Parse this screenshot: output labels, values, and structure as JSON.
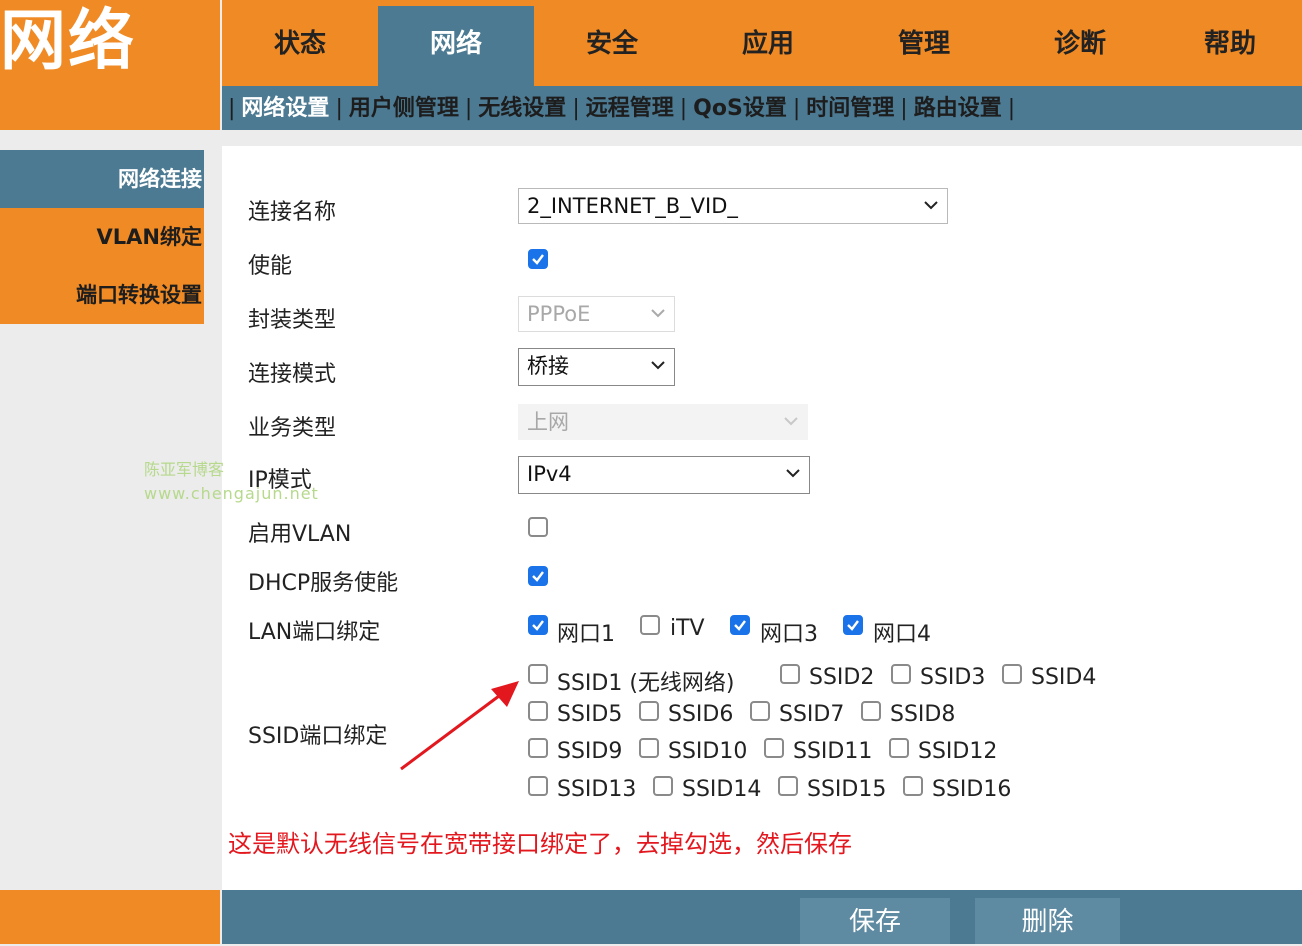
{
  "logo": {
    "text": "网络"
  },
  "topnav": {
    "tabs": [
      {
        "label": "状态",
        "active": false
      },
      {
        "label": "网络",
        "active": true
      },
      {
        "label": "安全",
        "active": false
      },
      {
        "label": "应用",
        "active": false
      },
      {
        "label": "管理",
        "active": false
      },
      {
        "label": "诊断",
        "active": false
      },
      {
        "label": "帮助",
        "active": false
      }
    ]
  },
  "subnav": {
    "items": [
      {
        "label": "网络设置",
        "active": true
      },
      {
        "label": "用户侧管理",
        "active": false
      },
      {
        "label": "无线设置",
        "active": false
      },
      {
        "label": "远程管理",
        "active": false
      },
      {
        "label": "QoS设置",
        "active": false
      },
      {
        "label": "时间管理",
        "active": false
      },
      {
        "label": "路由设置",
        "active": false
      }
    ],
    "separator": "|"
  },
  "sidebar": {
    "items": [
      {
        "label": "网络连接",
        "active": true
      },
      {
        "label": "VLAN绑定",
        "active": false
      },
      {
        "label": "端口转换设置",
        "active": false
      }
    ]
  },
  "form": {
    "connection_name": {
      "label": "连接名称",
      "value": "2_INTERNET_B_VID_"
    },
    "enable": {
      "label": "使能",
      "checked": true
    },
    "encap_type": {
      "label": "封装类型",
      "value": "PPPoE",
      "disabled": true
    },
    "connection_mode": {
      "label": "连接模式",
      "value": "桥接"
    },
    "service_type": {
      "label": "业务类型",
      "value": "上网",
      "disabled": true
    },
    "ip_mode": {
      "label": "IP模式",
      "value": "IPv4"
    },
    "enable_vlan": {
      "label": "启用VLAN",
      "checked": false
    },
    "dhcp_enable": {
      "label": "DHCP服务使能",
      "checked": true
    },
    "lan_binding": {
      "label": "LAN端口绑定",
      "ports": [
        {
          "label": "网口1",
          "checked": true
        },
        {
          "label": "iTV",
          "checked": false
        },
        {
          "label": "网口3",
          "checked": true
        },
        {
          "label": "网口4",
          "checked": true
        }
      ]
    },
    "ssid_binding": {
      "label": "SSID端口绑定",
      "rows": [
        [
          {
            "label": "SSID1 (无线网络)",
            "checked": false
          },
          {
            "label": "SSID2",
            "checked": false
          },
          {
            "label": "SSID3",
            "checked": false
          },
          {
            "label": "SSID4",
            "checked": false
          }
        ],
        [
          {
            "label": "SSID5",
            "checked": false
          },
          {
            "label": "SSID6",
            "checked": false
          },
          {
            "label": "SSID7",
            "checked": false
          },
          {
            "label": "SSID8",
            "checked": false
          }
        ],
        [
          {
            "label": "SSID9",
            "checked": false
          },
          {
            "label": "SSID10",
            "checked": false
          },
          {
            "label": "SSID11",
            "checked": false
          },
          {
            "label": "SSID12",
            "checked": false
          }
        ],
        [
          {
            "label": "SSID13",
            "checked": false
          },
          {
            "label": "SSID14",
            "checked": false
          },
          {
            "label": "SSID15",
            "checked": false
          },
          {
            "label": "SSID16",
            "checked": false
          }
        ]
      ]
    }
  },
  "annotation": {
    "text": "这是默认无线信号在宽带接口绑定了，去掉勾选，然后保存",
    "color": "#e3171e"
  },
  "watermark": {
    "line1": "陈亚军博客",
    "line2": "www.chengajun.net"
  },
  "footer": {
    "save_label": "保存",
    "delete_label": "删除"
  },
  "colors": {
    "orange": "#f08a24",
    "steel_blue": "#4c7a92",
    "checkbox_blue": "#1a73e8"
  }
}
